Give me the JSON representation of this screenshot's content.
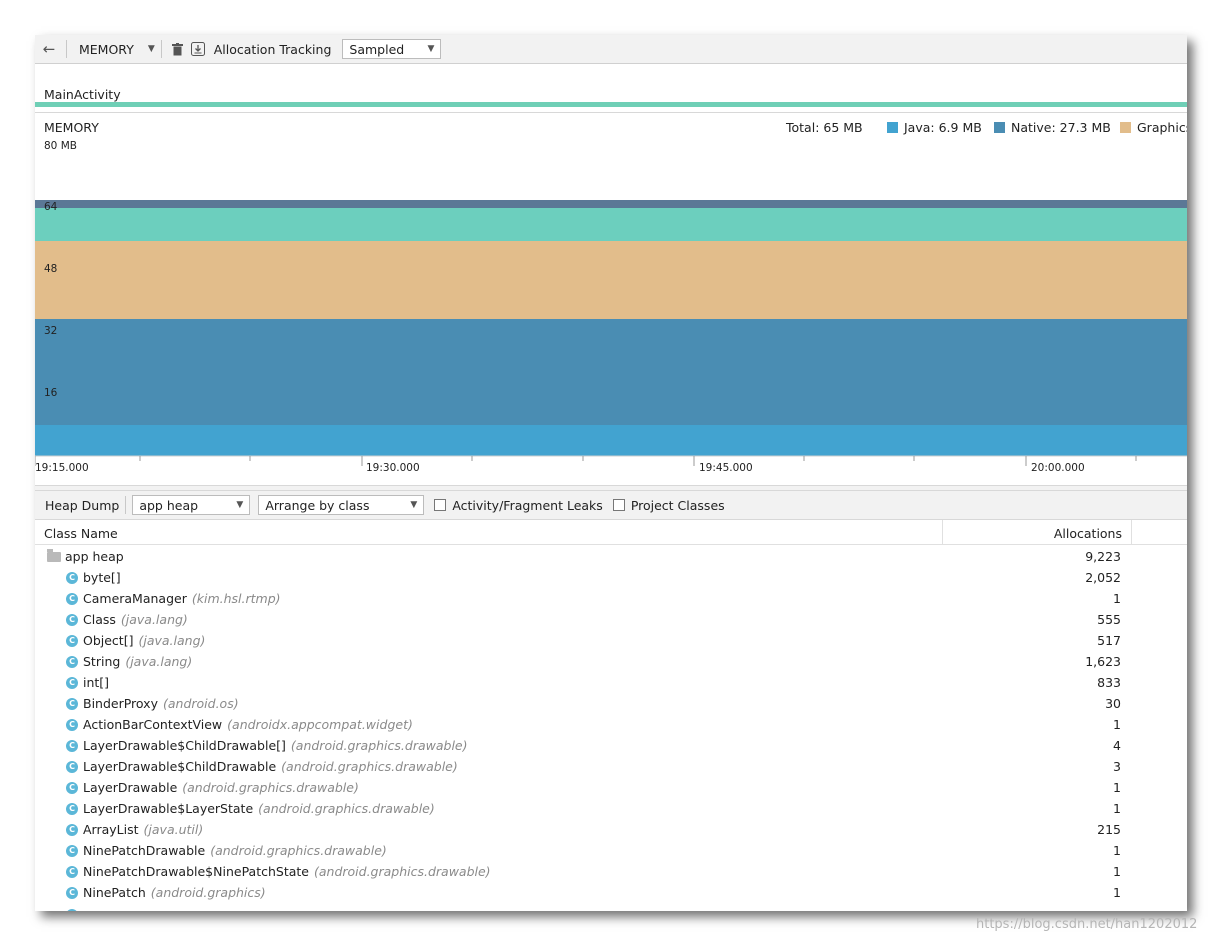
{
  "toolbar": {
    "profiler": "MEMORY",
    "allocation_tracking_label": "Allocation Tracking",
    "allocation_tracking_value": "Sampled"
  },
  "activity": {
    "label": "MainActivity"
  },
  "memory": {
    "title": "MEMORY",
    "total": "Total: 65 MB",
    "legend": [
      {
        "label": "Java: 6.9 MB",
        "color": "#42a3d0"
      },
      {
        "label": "Native: 27.3 MB",
        "color": "#4a8db3"
      },
      {
        "label": "Graphics",
        "color": "#e2bd8b"
      }
    ],
    "y_max_label": "80 MB",
    "y_ticks": [
      "64",
      "48",
      "32",
      "16"
    ],
    "time_labels": [
      "19:15.000",
      "19:30.000",
      "19:45.000",
      "20:00.000"
    ],
    "band_colors": {
      "java": "#42a3d0",
      "native": "#4a8db3",
      "graphics": "#e2bd8b",
      "code": "#6ccfbe",
      "others": "#5b7896"
    }
  },
  "heap": {
    "heap_dump_label": "Heap Dump",
    "heap_select": "app heap",
    "arrange_select": "Arrange by class",
    "leaks_label": "Activity/Fragment Leaks",
    "project_classes_label": "Project Classes"
  },
  "table": {
    "col_name": "Class Name",
    "col_allocations": "Allocations",
    "root": {
      "name": "app heap",
      "count": "9,223"
    },
    "rows": [
      {
        "name": "byte[]",
        "pkg": "",
        "count": "2,052"
      },
      {
        "name": "CameraManager",
        "pkg": "(kim.hsl.rtmp)",
        "count": "1"
      },
      {
        "name": "Class",
        "pkg": "(java.lang)",
        "count": "555"
      },
      {
        "name": "Object[]",
        "pkg": "(java.lang)",
        "count": "517"
      },
      {
        "name": "String",
        "pkg": "(java.lang)",
        "count": "1,623"
      },
      {
        "name": "int[]",
        "pkg": "",
        "count": "833"
      },
      {
        "name": "BinderProxy",
        "pkg": "(android.os)",
        "count": "30"
      },
      {
        "name": "ActionBarContextView",
        "pkg": "(androidx.appcompat.widget)",
        "count": "1"
      },
      {
        "name": "LayerDrawable$ChildDrawable[]",
        "pkg": "(android.graphics.drawable)",
        "count": "4"
      },
      {
        "name": "LayerDrawable$ChildDrawable",
        "pkg": "(android.graphics.drawable)",
        "count": "3"
      },
      {
        "name": "LayerDrawable",
        "pkg": "(android.graphics.drawable)",
        "count": "1"
      },
      {
        "name": "LayerDrawable$LayerState",
        "pkg": "(android.graphics.drawable)",
        "count": "1"
      },
      {
        "name": "ArrayList",
        "pkg": "(java.util)",
        "count": "215"
      },
      {
        "name": "NinePatchDrawable",
        "pkg": "(android.graphics.drawable)",
        "count": "1"
      },
      {
        "name": "NinePatchDrawable$NinePatchState",
        "pkg": "(android.graphics.drawable)",
        "count": "1"
      },
      {
        "name": "NinePatch",
        "pkg": "(android.graphics)",
        "count": "1"
      }
    ]
  },
  "watermark": "https://blog.csdn.net/han1202012"
}
